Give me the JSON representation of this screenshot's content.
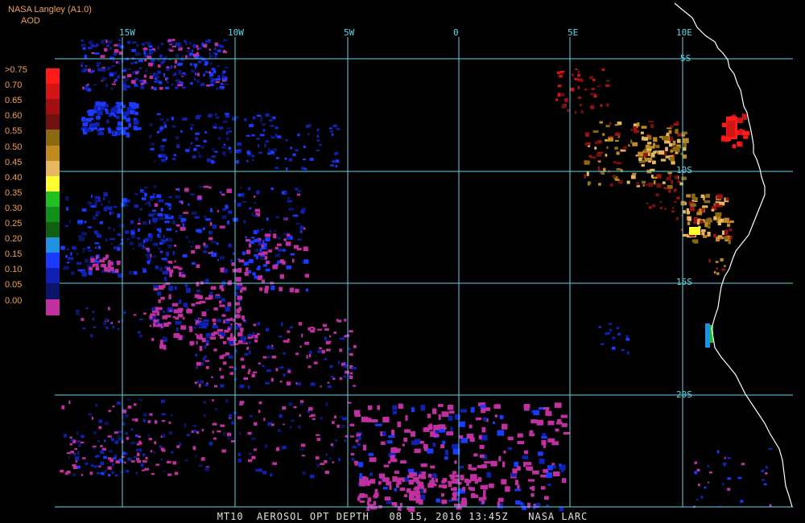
{
  "header": {
    "provider": "NASA Langley (A1.0)",
    "product": "AOD"
  },
  "caption": "MT10  AEROSOL OPT DEPTH   08 15, 2016 13:45Z   NASA LARC",
  "grid": {
    "color": "#5fd6e6",
    "longitudes": [
      "15W",
      "10W",
      "5W",
      "0",
      "5E",
      "10E"
    ],
    "latitudes": [
      "5S",
      "10S",
      "15S",
      "20S"
    ]
  },
  "coastline_color": "#ffffff",
  "legend": {
    "items": [
      {
        "label": ">0.75",
        "color": "#ff1a1a"
      },
      {
        "label": "0.70",
        "color": "#d11414"
      },
      {
        "label": "0.65",
        "color": "#a01010"
      },
      {
        "label": "0.60",
        "color": "#701010"
      },
      {
        "label": "0.55",
        "color": "#8a6a10"
      },
      {
        "label": "0.50",
        "color": "#c08a20"
      },
      {
        "label": "0.45",
        "color": "#e8b860"
      },
      {
        "label": "0.40",
        "color": "#ffff30"
      },
      {
        "label": "0.35",
        "color": "#20c020"
      },
      {
        "label": "0.30",
        "color": "#10901a"
      },
      {
        "label": "0.25",
        "color": "#106010"
      },
      {
        "label": "0.20",
        "color": "#2090e0"
      },
      {
        "label": "0.15",
        "color": "#1a3aff"
      },
      {
        "label": "0.10",
        "color": "#1020b0"
      },
      {
        "label": "0.05",
        "color": "#0a1468"
      },
      {
        "label": "0.00",
        "color": "#c030a0"
      }
    ]
  }
}
